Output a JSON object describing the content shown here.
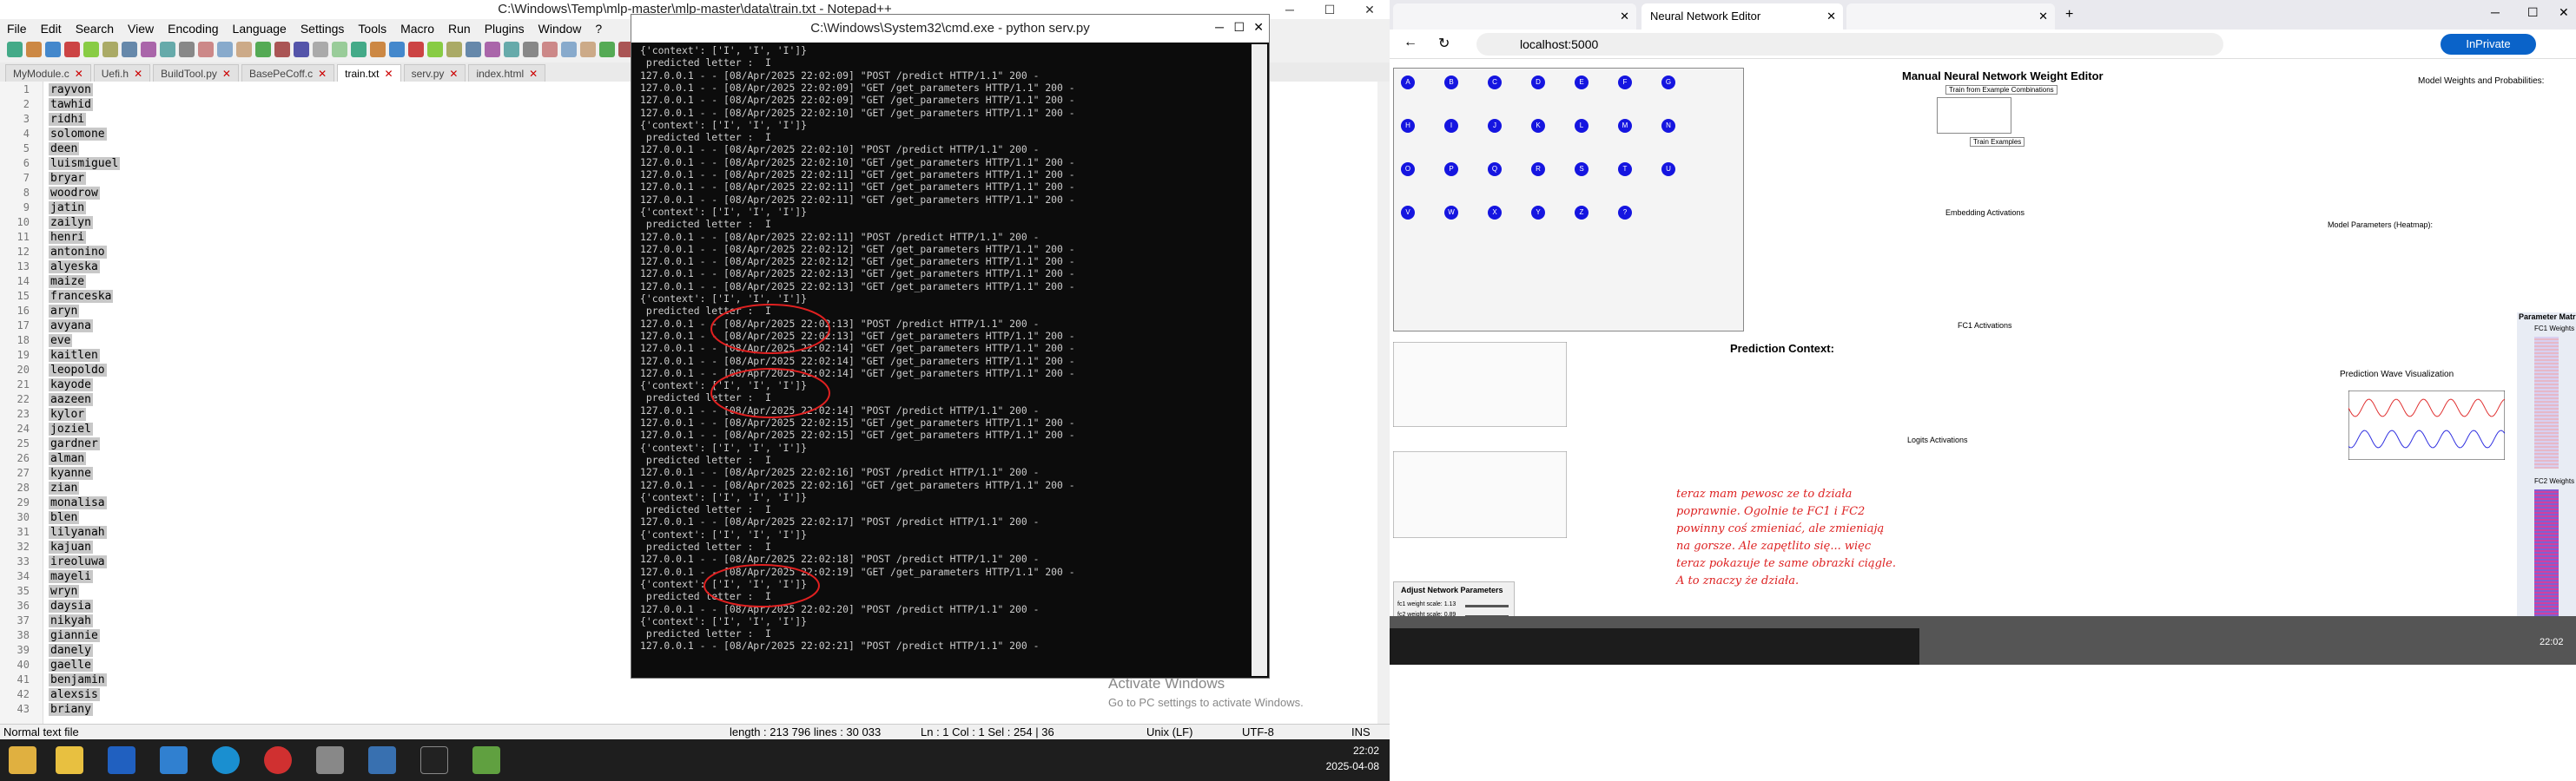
{
  "npp": {
    "title": "C:\\Windows\\Temp\\mlp-master\\mlp-master\\data\\train.txt - Notepad++",
    "menu": [
      "File",
      "Edit",
      "Search",
      "View",
      "Encoding",
      "Language",
      "Settings",
      "Tools",
      "Macro",
      "Run",
      "Plugins",
      "Window",
      "?"
    ],
    "tabs": [
      {
        "label": "MyModule.c",
        "active": false
      },
      {
        "label": "Uefi.h",
        "active": false
      },
      {
        "label": "BuildTool.py",
        "active": false
      },
      {
        "label": "BasePeCoff.c",
        "active": false
      },
      {
        "label": "train.txt",
        "active": true
      },
      {
        "label": "serv.py",
        "active": false
      },
      {
        "label": "index.html",
        "active": false
      }
    ],
    "lines": [
      "rayvon",
      "tawhid",
      "ridhi",
      "solomone",
      "deen",
      "luismiguel",
      "bryar",
      "woodrow",
      "jatin",
      "zailyn",
      "henri",
      "antonino",
      "alyeska",
      "maize",
      "franceska",
      "aryn",
      "avyana",
      "eve",
      "kaitlen",
      "leopoldo",
      "kayode",
      "aazeen",
      "kylor",
      "joziel",
      "gardner",
      "alman",
      "kyanne",
      "zian",
      "monalisa",
      "blen",
      "lilyanah",
      "kajuan",
      "ireoluwa",
      "mayeli",
      "wryn",
      "daysia",
      "nikyah",
      "giannie",
      "danely",
      "gaelle",
      "benjamin",
      "alexsis",
      "briany"
    ],
    "status": {
      "type": "Normal text file",
      "length": "length : 213 796   lines : 30 033",
      "pos": "Ln : 1   Col : 1   Sel : 254 | 36",
      "eol": "Unix (LF)",
      "enc": "UTF-8",
      "ins": "INS"
    }
  },
  "cmd": {
    "title": "C:\\Windows\\System32\\cmd.exe - python  serv.py",
    "lines": [
      "{'context': ['I', 'I', 'I']}",
      " predicted letter :  I",
      "127.0.0.1 - - [08/Apr/2025 22:02:09] \"POST /predict HTTP/1.1\" 200 -",
      "127.0.0.1 - - [08/Apr/2025 22:02:09] \"GET /get_parameters HTTP/1.1\" 200 -",
      "127.0.0.1 - - [08/Apr/2025 22:02:09] \"GET /get_parameters HTTP/1.1\" 200 -",
      "127.0.0.1 - - [08/Apr/2025 22:02:10] \"GET /get_parameters HTTP/1.1\" 200 -",
      "{'context': ['I', 'I', 'I']}",
      " predicted letter :  I",
      "127.0.0.1 - - [08/Apr/2025 22:02:10] \"POST /predict HTTP/1.1\" 200 -",
      "127.0.0.1 - - [08/Apr/2025 22:02:10] \"GET /get_parameters HTTP/1.1\" 200 -",
      "127.0.0.1 - - [08/Apr/2025 22:02:11] \"GET /get_parameters HTTP/1.1\" 200 -",
      "127.0.0.1 - - [08/Apr/2025 22:02:11] \"GET /get_parameters HTTP/1.1\" 200 -",
      "127.0.0.1 - - [08/Apr/2025 22:02:11] \"GET /get_parameters HTTP/1.1\" 200 -",
      "{'context': ['I', 'I', 'I']}",
      " predicted letter :  I",
      "127.0.0.1 - - [08/Apr/2025 22:02:11] \"POST /predict HTTP/1.1\" 200 -",
      "127.0.0.1 - - [08/Apr/2025 22:02:12] \"GET /get_parameters HTTP/1.1\" 200 -",
      "127.0.0.1 - - [08/Apr/2025 22:02:12] \"GET /get_parameters HTTP/1.1\" 200 -",
      "127.0.0.1 - - [08/Apr/2025 22:02:13] \"GET /get_parameters HTTP/1.1\" 200 -",
      "127.0.0.1 - - [08/Apr/2025 22:02:13] \"GET /get_parameters HTTP/1.1\" 200 -",
      "{'context': ['I', 'I', 'I']}",
      " predicted letter :  I",
      "127.0.0.1 - - [08/Apr/2025 22:02:13] \"POST /predict HTTP/1.1\" 200 -",
      "127.0.0.1 - - [08/Apr/2025 22:02:13] \"GET /get_parameters HTTP/1.1\" 200 -",
      "127.0.0.1 - - [08/Apr/2025 22:02:14] \"GET /get_parameters HTTP/1.1\" 200 -",
      "127.0.0.1 - - [08/Apr/2025 22:02:14] \"GET /get_parameters HTTP/1.1\" 200 -",
      "127.0.0.1 - - [08/Apr/2025 22:02:14] \"GET /get_parameters HTTP/1.1\" 200 -",
      "{'context': ['I', 'I', 'I']}",
      " predicted letter :  I",
      "127.0.0.1 - - [08/Apr/2025 22:02:14] \"POST /predict HTTP/1.1\" 200 -",
      "127.0.0.1 - - [08/Apr/2025 22:02:15] \"GET /get_parameters HTTP/1.1\" 200 -",
      "127.0.0.1 - - [08/Apr/2025 22:02:15] \"GET /get_parameters HTTP/1.1\" 200 -",
      "{'context': ['I', 'I', 'I']}",
      " predicted letter :  I",
      "127.0.0.1 - - [08/Apr/2025 22:02:16] \"POST /predict HTTP/1.1\" 200 -",
      "127.0.0.1 - - [08/Apr/2025 22:02:16] \"GET /get_parameters HTTP/1.1\" 200 -",
      "{'context': ['I', 'I', 'I']}",
      " predicted letter :  I",
      "127.0.0.1 - - [08/Apr/2025 22:02:17] \"POST /predict HTTP/1.1\" 200 -",
      "{'context': ['I', 'I', 'I']}",
      " predicted letter :  I",
      "127.0.0.1 - - [08/Apr/2025 22:02:18] \"POST /predict HTTP/1.1\" 200 -",
      "127.0.0.1 - - [08/Apr/2025 22:02:19] \"GET /get_parameters HTTP/1.1\" 200 -",
      "{'context': ['I', 'I', 'I']}",
      " predicted letter :  I",
      "127.0.0.1 - - [08/Apr/2025 22:02:20] \"POST /predict HTTP/1.1\" 200 -",
      "{'context': ['I', 'I', 'I']}",
      " predicted letter :  I",
      "127.0.0.1 - - [08/Apr/2025 22:02:21] \"POST /predict HTTP/1.1\" 200 -"
    ],
    "watermark": [
      "Activate Windows",
      "Go to PC settings to activate Windows."
    ]
  },
  "browser": {
    "tab1": "",
    "tab2": "Neural Network Editor",
    "url": "localhost:5000",
    "inprivate": "InPrivate",
    "heading": "Manual Neural Network Weight Editor",
    "train_btn": "Train from Example Combinations",
    "train_btn2": "Train Examples",
    "right_title": "Model Weights and Probabilities:",
    "embedding": "Embedding Activations",
    "model_pe": "Model Parameters (Heatmap):",
    "fc1": "FC1 Activations",
    "pred_ctx": "Prediction Context:",
    "logits": "Logits Activations",
    "wave": "Prediction Wave Visualization",
    "heatmap_title": "Parameter Matrices Heatmap",
    "fc1_weights": "FC1 Weights",
    "fc2_weights": "FC2 Weights",
    "adjust": "Adjust Network Parameters",
    "fc1_scale": "fc1 weight scale: 1.13",
    "fc2_scale": "fc2 weight scale: 0.89",
    "nodes": [
      "A",
      "B",
      "C",
      "D",
      "E",
      "F",
      "G",
      "H",
      "I",
      "J",
      "K",
      "L",
      "M",
      "N",
      "O",
      "P",
      "Q",
      "R",
      "S",
      "T",
      "U",
      "V",
      "W",
      "X",
      "Y",
      "Z",
      "?"
    ],
    "note": [
      "teraz mam pewosc ze to działa",
      "poprawnie. Ogolnie te FC1 i FC2",
      "powinny coś zmieniać, ale zmieniają",
      "na gorsze. Ale zapętlito się... więc",
      "teraz pokazuje te same obrazki ciągle.",
      "A to znaczy że działa."
    ]
  },
  "taskbar": {
    "time": "22:02",
    "date": "2025-04-08",
    "right_time": "22:02"
  }
}
